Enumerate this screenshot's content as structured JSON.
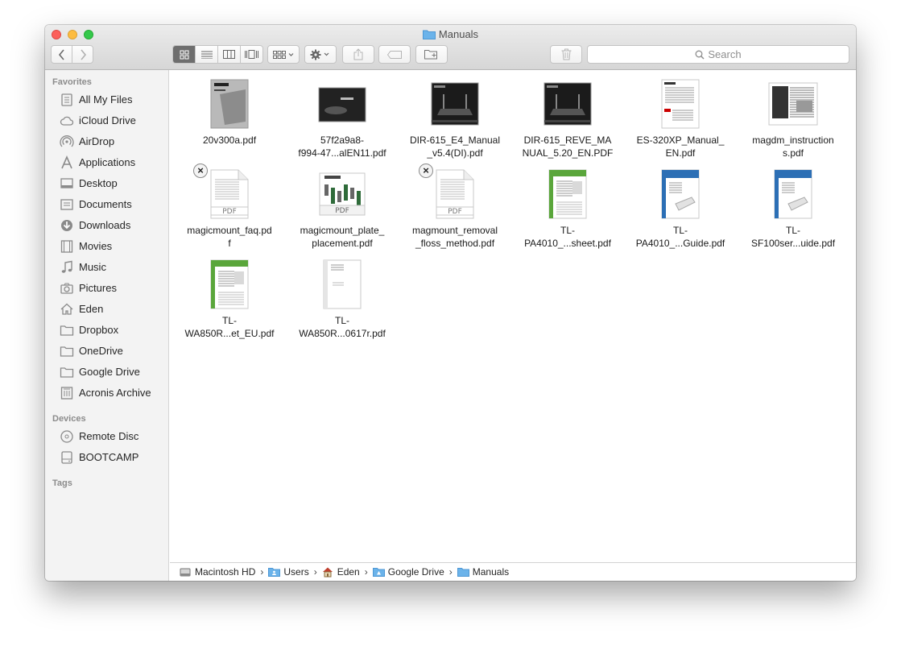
{
  "window": {
    "title": "Manuals"
  },
  "toolbar": {
    "search_placeholder": "Search"
  },
  "sidebar": {
    "favorites_header": "Favorites",
    "favorites": [
      {
        "label": "All My Files",
        "icon": "all-files-icon"
      },
      {
        "label": "iCloud Drive",
        "icon": "cloud-icon"
      },
      {
        "label": "AirDrop",
        "icon": "airdrop-icon"
      },
      {
        "label": "Applications",
        "icon": "applications-icon"
      },
      {
        "label": "Desktop",
        "icon": "desktop-icon"
      },
      {
        "label": "Documents",
        "icon": "documents-icon"
      },
      {
        "label": "Downloads",
        "icon": "downloads-icon"
      },
      {
        "label": "Movies",
        "icon": "movies-icon"
      },
      {
        "label": "Music",
        "icon": "music-icon"
      },
      {
        "label": "Pictures",
        "icon": "camera-icon"
      },
      {
        "label": "Eden",
        "icon": "home-icon"
      },
      {
        "label": "Dropbox",
        "icon": "folder-icon"
      },
      {
        "label": "OneDrive",
        "icon": "folder-icon"
      },
      {
        "label": "Google Drive",
        "icon": "folder-icon"
      },
      {
        "label": "Acronis Archive",
        "icon": "archive-icon"
      }
    ],
    "devices_header": "Devices",
    "devices": [
      {
        "label": "Remote Disc",
        "icon": "disc-icon"
      },
      {
        "label": "BOOTCAMP",
        "icon": "drive-icon"
      }
    ],
    "tags_header": "Tags"
  },
  "files": [
    {
      "lines": [
        "20v300a.pdf"
      ],
      "thumb": "gray",
      "badge": false
    },
    {
      "lines": [
        "57f2a9a8-",
        "f994-47...alEN11.pdf"
      ],
      "thumb": "dark",
      "badge": false
    },
    {
      "lines": [
        "DIR-615_E4_Manual",
        "_v5.4(DI).pdf"
      ],
      "thumb": "router",
      "badge": false
    },
    {
      "lines": [
        "DIR-615_REVE_MA",
        "NUAL_5.20_EN.PDF"
      ],
      "thumb": "router",
      "badge": false
    },
    {
      "lines": [
        "ES-320XP_Manual_",
        "EN.pdf"
      ],
      "thumb": "doc",
      "badge": false
    },
    {
      "lines": [
        "magdm_instruction",
        "s.pdf"
      ],
      "thumb": "table",
      "badge": false
    },
    {
      "lines": [
        "magicmount_faq.pd",
        "f"
      ],
      "thumb": "pdfblank",
      "badge": true
    },
    {
      "lines": [
        "magicmount_plate_",
        "placement.pdf"
      ],
      "thumb": "chart",
      "badge": false
    },
    {
      "lines": [
        "magmount_removal",
        "_floss_method.pdf"
      ],
      "thumb": "pdfblank",
      "badge": true
    },
    {
      "lines": [
        "TL-",
        "PA4010_...sheet.pdf"
      ],
      "thumb": "green",
      "badge": false
    },
    {
      "lines": [
        "TL-",
        "PA4010_...Guide.pdf"
      ],
      "thumb": "blue",
      "badge": false
    },
    {
      "lines": [
        "TL-",
        "SF100ser...uide.pdf"
      ],
      "thumb": "blue",
      "badge": false
    },
    {
      "lines": [
        "TL-",
        "WA850R...et_EU.pdf"
      ],
      "thumb": "green",
      "badge": false
    },
    {
      "lines": [
        "TL-",
        "WA850R...0617r.pdf"
      ],
      "thumb": "plain",
      "badge": false
    }
  ],
  "pathbar": [
    {
      "label": "Macintosh HD",
      "icon": "hd-icon"
    },
    {
      "label": "Users",
      "icon": "users-folder-icon"
    },
    {
      "label": "Eden",
      "icon": "home-icon"
    },
    {
      "label": "Google Drive",
      "icon": "gdrive-folder-icon"
    },
    {
      "label": "Manuals",
      "icon": "folder-icon"
    }
  ],
  "colors": {
    "folder_blue": "#6bb3ea",
    "selected_segment": "#6e6e6e",
    "sidebar_bg": "#f3f3f3"
  }
}
